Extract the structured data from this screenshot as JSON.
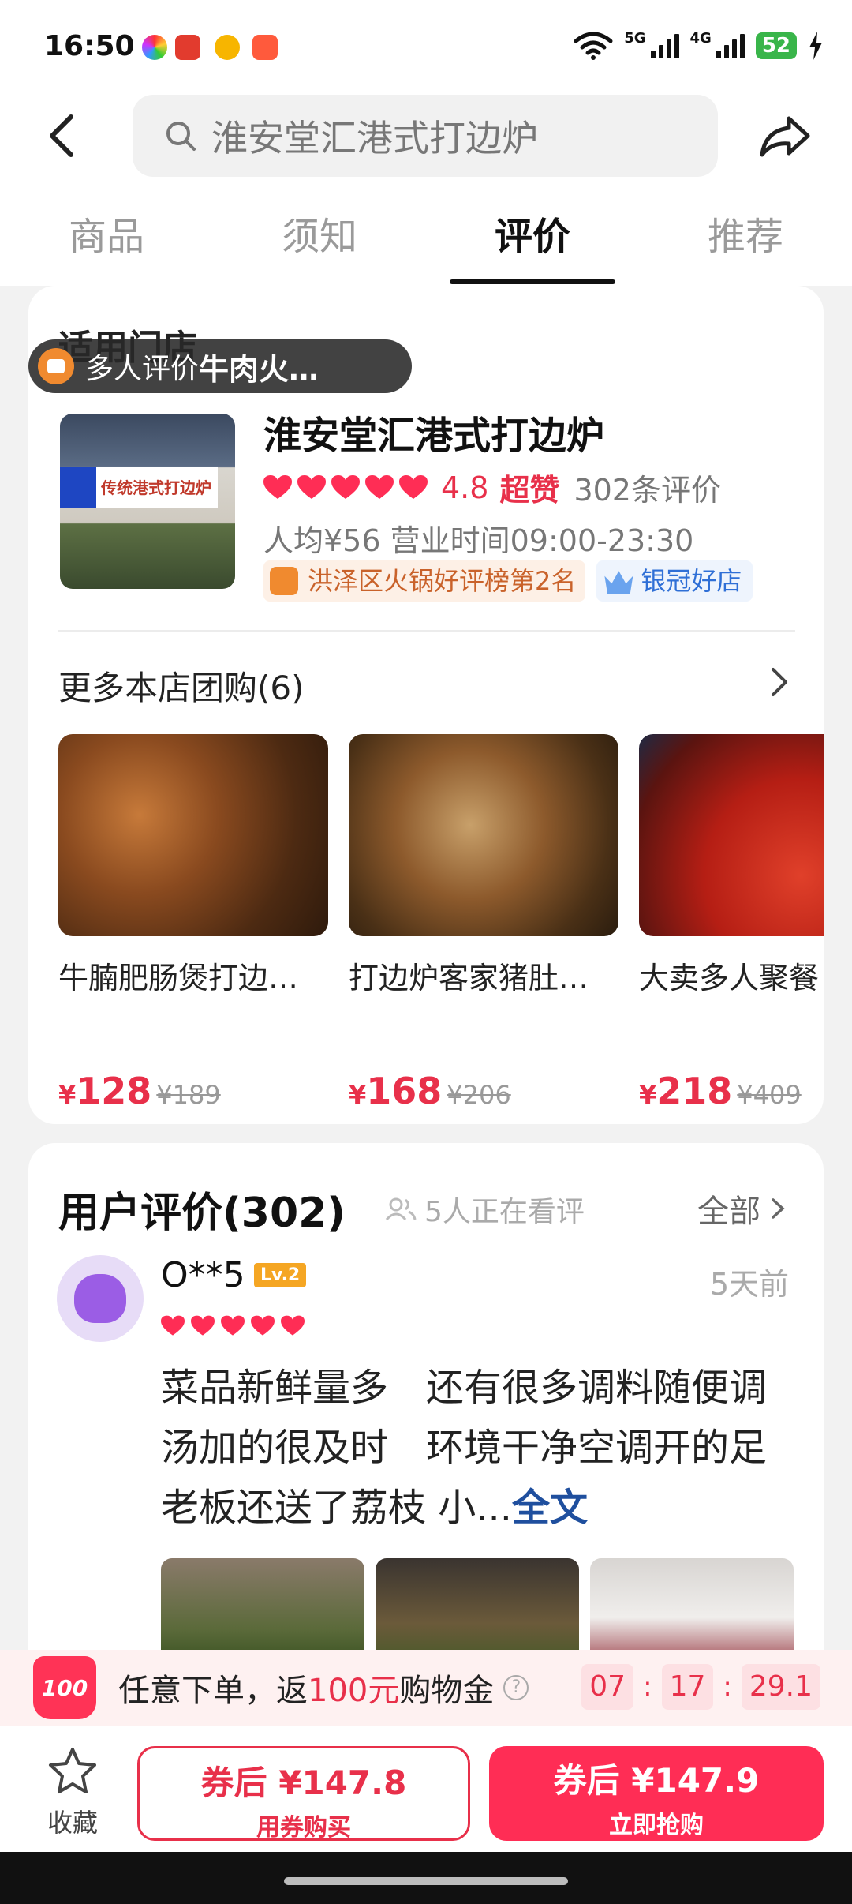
{
  "status_bar": {
    "time": "16:50",
    "network_a": "5G",
    "network_b": "4G",
    "battery": "52",
    "app_icons": [
      "photos-icon",
      "sogou-icon",
      "weibo-icon",
      "app-icon"
    ]
  },
  "header": {
    "search_text": "淮安堂汇港式打边炉",
    "tabs": [
      "商品",
      "须知",
      "评价",
      "推荐"
    ],
    "active_tab": "评价"
  },
  "store_section": {
    "section_title_peek": "适用门店",
    "overlay_pill": {
      "label": "多人评价",
      "item": "牛肉火…"
    },
    "store_name": "淮安堂汇港式打边炉",
    "sign_text": "传统港式打边炉",
    "hearts": 5,
    "rating": "4.8",
    "rating_word": "超赞",
    "review_count": "302条评价",
    "meta": "人均¥56  营业时间09:00-23:30",
    "badge_rank": "洪泽区火锅好评榜第2名",
    "badge_silver": "银冠好店"
  },
  "more_deals": {
    "title": "更多本店团购(6)",
    "items": [
      {
        "name": "牛腩肥肠煲打边…",
        "price_symbol": "¥",
        "price": "128",
        "original": "¥189"
      },
      {
        "name": "打边炉客家猪肚…",
        "price_symbol": "¥",
        "price": "168",
        "original": "¥206"
      },
      {
        "name": "大卖多人聚餐",
        "price_symbol": "¥",
        "price": "218",
        "original": "¥409"
      }
    ]
  },
  "reviews": {
    "title": "用户评价(302)",
    "viewers": "5人正在看评",
    "all_label": "全部",
    "review": {
      "username": "O**5",
      "level": "Lv.2",
      "time": "5天前",
      "hearts": 5,
      "text": "菜品新鲜量多　还有很多调料随便调　汤加的很及时　环境干净空调开的足  老板还送了荔枝  小...",
      "full_text_label": "全文"
    }
  },
  "promo": {
    "badge": "100",
    "text_prefix": "任意下单，返",
    "highlight": "100元",
    "text_suffix": "购物金",
    "help": "?",
    "timer": [
      "07",
      "17",
      "29.1"
    ]
  },
  "bottom_bar": {
    "favorite": "收藏",
    "coupon_button": {
      "line1": "券后 ¥147.8",
      "line2": "用券购买"
    },
    "buy_button": {
      "line1": "券后 ¥147.9",
      "line2": "立即抢购"
    }
  },
  "colors": {
    "accent": "#e8304a",
    "buy_button": "#ff2d55",
    "link_blue": "#1f4f9e"
  }
}
